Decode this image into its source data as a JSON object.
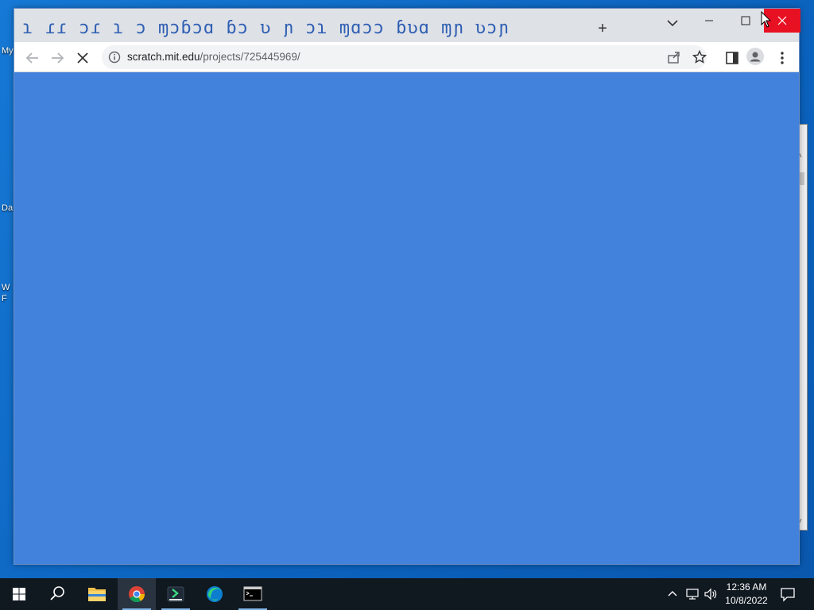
{
  "desktop": {
    "labels": [
      "My",
      "Da",
      "W",
      "F"
    ]
  },
  "browser": {
    "tab_title": "ɿ ɾɾ ɔɾ ɿ ɔ ɱɔɓɔɑ ɓɔ ʋ ɲ ɔɿ ɱɑɔɔ ɓʋɑ ɱɲ ʋɔɲ",
    "new_tab_label": "+",
    "url_host": "scratch.mit.edu",
    "url_path": "/projects/725445969/",
    "colors": {
      "content": "#4382dc",
      "close_button": "#e81123",
      "tabstrip": "#dee1e6"
    }
  },
  "taskbar": {
    "time": "12:36 AM",
    "date": "10/8/2022",
    "apps": [
      "windows-start",
      "search",
      "file-explorer",
      "chrome",
      "app-installer",
      "edge",
      "terminal"
    ]
  }
}
